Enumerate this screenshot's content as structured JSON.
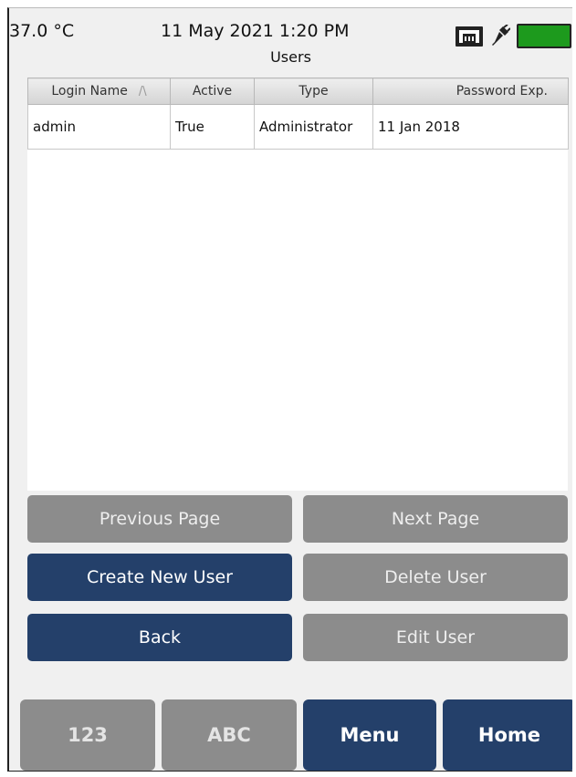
{
  "status": {
    "temperature": "37.0 °C",
    "datetime": "11 May 2021 1:20 PM",
    "screen_title": "Users",
    "icons": [
      "network-icon",
      "plug-icon",
      "battery-icon"
    ],
    "battery_color": "#1d9a1d"
  },
  "table": {
    "headers": {
      "login_name": "Login Name",
      "active": "Active",
      "type": "Type",
      "password_exp": "Password Exp."
    },
    "sort_indicator": "/\\",
    "rows": [
      {
        "login_name": "admin",
        "active": "True",
        "type": "Administrator",
        "password_exp": "11 Jan 2018"
      }
    ]
  },
  "buttons": {
    "previous_page": "Previous Page",
    "next_page": "Next Page",
    "create_new_user": "Create New User",
    "delete_user": "Delete User",
    "back": "Back",
    "edit_user": "Edit User"
  },
  "nav": {
    "num": "123",
    "abc": "ABC",
    "menu": "Menu",
    "home": "Home"
  },
  "colors": {
    "accent_blue": "#24406a",
    "disabled_gray": "#8c8c8c"
  }
}
